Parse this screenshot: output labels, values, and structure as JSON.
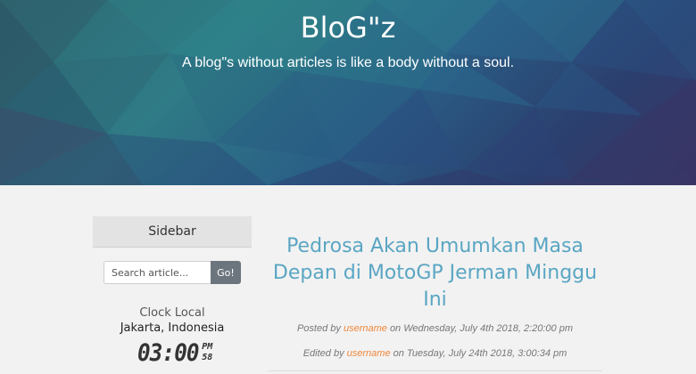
{
  "header": {
    "title": "BloG\"z",
    "tagline": "A blog\"s without articles is like a body without a soul."
  },
  "sidebar": {
    "heading": "Sidebar",
    "search": {
      "placeholder": "Search article...",
      "value": "",
      "button_label": "Go!"
    },
    "clock": {
      "title": "Clock Local",
      "location": "Jakarta, Indonesia",
      "time": "03:00",
      "ampm": "PM",
      "seconds": "58"
    }
  },
  "post": {
    "title": "Pedrosa Akan Umumkan Masa Depan di MotoGP Jerman Minggu Ini",
    "posted_prefix": "Posted by",
    "posted_user": "username",
    "posted_suffix": "on Wednesday, July 4th 2018, 2:20:00 pm",
    "edited_prefix": "Edited by",
    "edited_user": "username",
    "edited_suffix": "on Tuesday, July 24th 2018, 3:00:34 pm"
  },
  "colors": {
    "title_accent": "#5aa6c3",
    "username_accent": "#f0883c",
    "button_gray": "#6c757d"
  }
}
